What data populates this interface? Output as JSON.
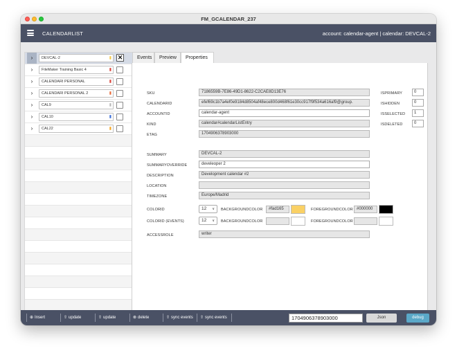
{
  "window": {
    "title": "FM_GCALENDAR_237"
  },
  "appbar": {
    "title": "CALENDARLIST",
    "account_info": "account: calendar-agent | calendar: DEVCAL-2"
  },
  "calendar_list": [
    {
      "name": "DEVCAL-2",
      "color": "#f5c94a",
      "selected": true
    },
    {
      "name": "FileMaker Training Basic 4",
      "color": "#d9453c",
      "selected": false
    },
    {
      "name": "CALENDARI PERSONAL",
      "color": "#d9453c",
      "selected": false
    },
    {
      "name": "CALENDARI PERSONAL 2",
      "color": "#e86b3a",
      "selected": false
    },
    {
      "name": "CAL9",
      "color": "#b9b9b9",
      "selected": false
    },
    {
      "name": "CAL10",
      "color": "#3b6fd9",
      "selected": false
    },
    {
      "name": "CAL22",
      "color": "#f5a623",
      "selected": false
    }
  ],
  "tabs": [
    {
      "label": "Events",
      "active": false
    },
    {
      "label": "Preview",
      "active": false
    },
    {
      "label": "Properties",
      "active": true
    }
  ],
  "properties": {
    "sku": {
      "label": "SKU",
      "value": "7186559B-7E86-49D1-8622-C2CAE8D13E76"
    },
    "calendarid": {
      "label": "CALENDARID",
      "value": "efef69c1b7a4ef0e9184d8504af48ece800d468f61e30cc917f9f534a616af9@group."
    },
    "accountid": {
      "label": "ACCOUNTID",
      "value": "calendar-agent"
    },
    "kind": {
      "label": "KIND",
      "value": "calendar#calendarListEntry"
    },
    "etag": {
      "label": "ETAG",
      "value": "1704906378903000"
    },
    "summary": {
      "label": "SUMMARY",
      "value": "DEVCAL-2"
    },
    "summaryoverride": {
      "label": "SUMMARYOVERRIDE",
      "value": "develeoper 2"
    },
    "description": {
      "label": "DESCRIPTION",
      "value": "Development calendar #2"
    },
    "location": {
      "label": "LOCATION",
      "value": ""
    },
    "timezone": {
      "label": "TIMEZONE",
      "value": "Europe/Madrid"
    },
    "colorid": {
      "label": "COLORID",
      "value": "12"
    },
    "backgroundcolor": {
      "label": "BACKGROUNDCOLOR",
      "value": "#fad165",
      "swatch": "#fad165"
    },
    "foregroundcolor": {
      "label": "FOREGROUNDCOLOR",
      "value": "#000000",
      "swatch": "#000000"
    },
    "colorid_events": {
      "label": "COLORID (EVENTS)",
      "value": "12"
    },
    "backgroundcolor_events": {
      "label": "BACKGROUNDCOLOR",
      "value": "",
      "swatch": "#ffffff"
    },
    "foregroundcolor_events": {
      "label": "FOREGROUNDCOLOR",
      "value": "",
      "swatch": "#ffffff"
    },
    "accessrole": {
      "label": "ACCESSROLE",
      "value": "writer"
    },
    "isprimary": {
      "label": "ISPRIMARY",
      "value": "0"
    },
    "ishidden": {
      "label": "ISHIDDEN",
      "value": "0"
    },
    "isselected": {
      "label": "ISSELECTED",
      "value": "1"
    },
    "isdeleted": {
      "label": "ISDELETED",
      "value": "0"
    }
  },
  "bottombar": {
    "insert": "Insert",
    "update1": "update",
    "update2": "update",
    "delete": "delete",
    "sync_events1": "sync events",
    "sync_events2": "sync events",
    "timestamp": "1704906378903000",
    "json": "Json",
    "debug": "debug"
  }
}
